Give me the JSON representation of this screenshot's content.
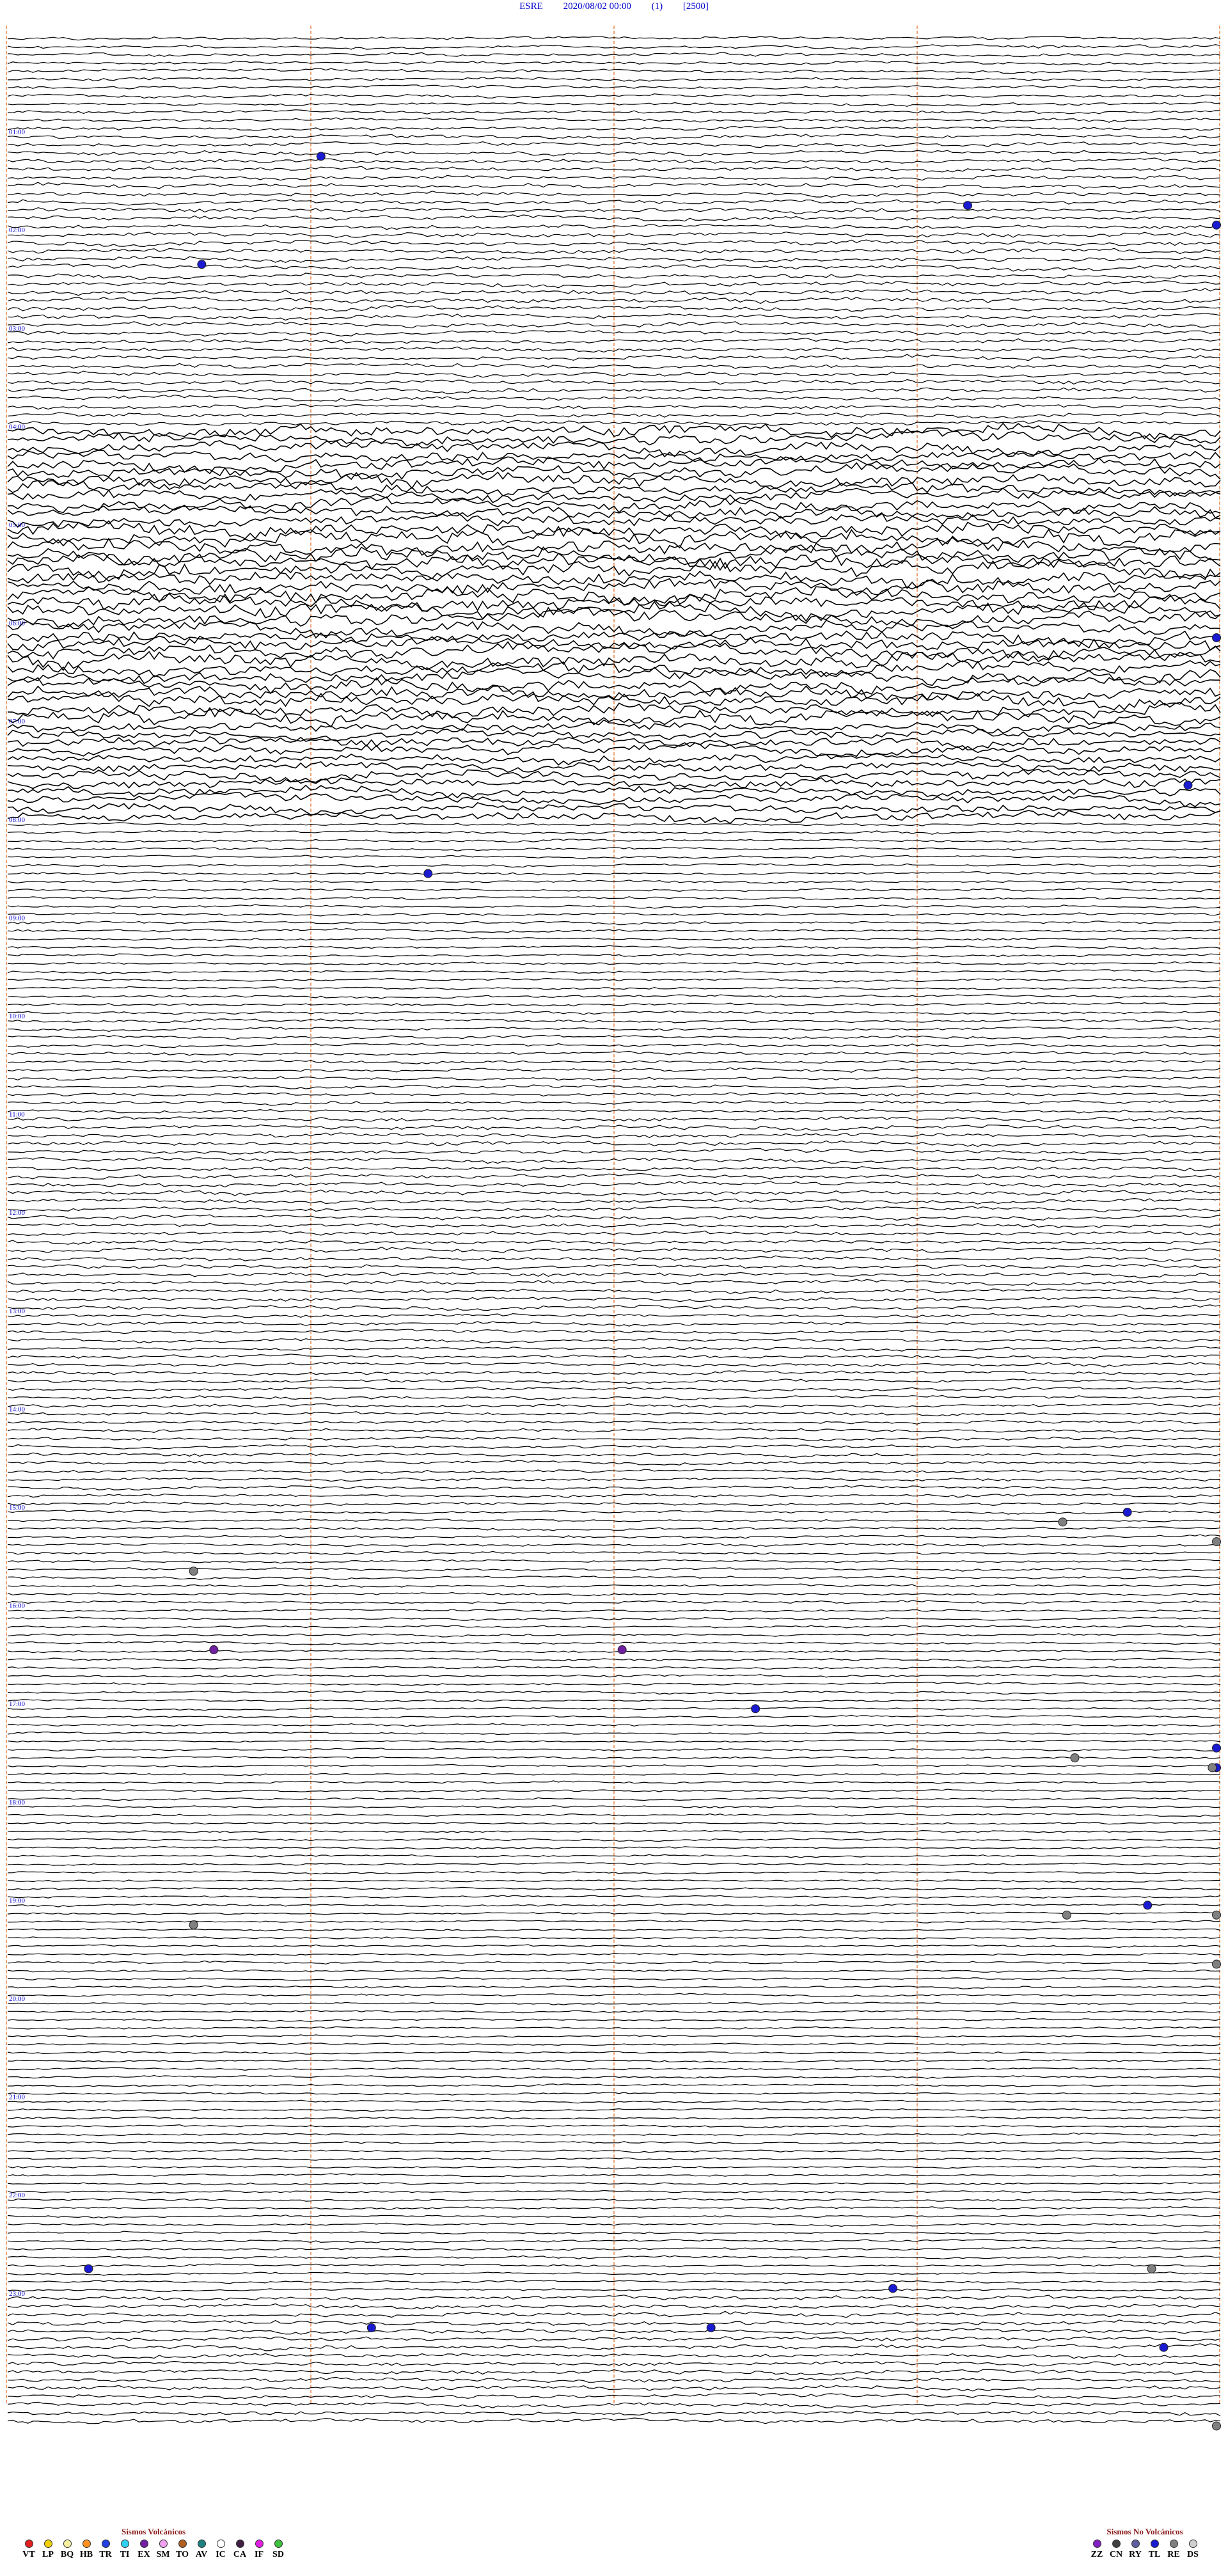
{
  "header": {
    "station": "ESRE",
    "datetime": "2020/08/02 00:00",
    "component": "(1)",
    "scale": "[2500]"
  },
  "chart_data": {
    "type": "line",
    "title": "ESRE 2020/08/02 00:00 (1) [2500]",
    "description_kind": "helicorder",
    "xlim_minutes": [
      0,
      60
    ],
    "minute_markers": [
      15,
      30,
      45,
      60
    ],
    "minute_marker_color": "#e8864a",
    "trace_color": "#000000",
    "hour_labels": [
      "01:00",
      "02:00",
      "03:00",
      "04:00",
      "05:00",
      "06:00",
      "07:00",
      "08:00",
      "09:00",
      "10:00",
      "11:00",
      "12:00",
      "13:00",
      "14:00",
      "15:00",
      "16:00",
      "17:00",
      "18:00",
      "19:00",
      "20:00",
      "21:00",
      "22:00",
      "23:00"
    ],
    "noise_profile_by_hour": [
      1.2,
      1.6,
      1.8,
      1.6,
      4.5,
      5.5,
      5.0,
      3.5,
      1.0,
      1.0,
      1.2,
      1.6,
      1.5,
      1.3,
      1.2,
      1.0,
      0.9,
      0.8,
      0.8,
      0.8,
      0.8,
      0.8,
      0.9,
      1.6
    ],
    "events": [
      {
        "hour": 1.2,
        "minute": 15.5,
        "type": "TL"
      },
      {
        "hour": 1.7,
        "minute": 47.5,
        "type": "TL"
      },
      {
        "hour": 1.9,
        "minute": 63.8,
        "type": "TL"
      },
      {
        "hour": 2.3,
        "minute": 9.6,
        "type": "TL"
      },
      {
        "hour": 6.1,
        "minute": 60.8,
        "type": "TL"
      },
      {
        "hour": 7.6,
        "minute": 58.4,
        "type": "TL"
      },
      {
        "hour": 8.5,
        "minute": 20.8,
        "type": "TL"
      },
      {
        "hour": 15.0,
        "minute": 55.4,
        "type": "TL"
      },
      {
        "hour": 17.0,
        "minute": 37.0,
        "type": "TL"
      },
      {
        "hour": 17.4,
        "minute": 60.8,
        "type": "TL"
      },
      {
        "hour": 17.6,
        "minute": 63.2,
        "type": "TL"
      },
      {
        "hour": 19.0,
        "minute": 56.4,
        "type": "TL"
      },
      {
        "hour": 22.7,
        "minute": 4.0,
        "type": "TL"
      },
      {
        "hour": 22.9,
        "minute": 43.8,
        "type": "TL"
      },
      {
        "hour": 23.3,
        "minute": 18.0,
        "type": "TL"
      },
      {
        "hour": 23.3,
        "minute": 34.8,
        "type": "TL"
      },
      {
        "hour": 23.5,
        "minute": 57.2,
        "type": "TL"
      },
      {
        "hour": 16.4,
        "minute": 10.2,
        "type": "EX"
      },
      {
        "hour": 16.4,
        "minute": 30.4,
        "type": "EX"
      },
      {
        "hour": 15.6,
        "minute": 9.2,
        "type": "RE"
      },
      {
        "hour": 19.2,
        "minute": 9.2,
        "type": "RE"
      },
      {
        "hour": 15.1,
        "minute": 52.2,
        "type": "RE"
      },
      {
        "hour": 15.3,
        "minute": 71.0,
        "type": "RE"
      },
      {
        "hour": 17.5,
        "minute": 52.8,
        "type": "RE"
      },
      {
        "hour": 17.6,
        "minute": 59.6,
        "type": "RE"
      },
      {
        "hour": 19.1,
        "minute": 52.4,
        "type": "RE"
      },
      {
        "hour": 19.1,
        "minute": 67.4,
        "type": "RE"
      },
      {
        "hour": 19.6,
        "minute": 66.6,
        "type": "RE"
      },
      {
        "hour": 22.7,
        "minute": 56.6,
        "type": "RE"
      },
      {
        "hour": 24.3,
        "minute": 69.4,
        "type": "RE"
      }
    ],
    "legend_volcanic": {
      "title": "Sismos Volcánicos",
      "items": [
        {
          "label": "VT",
          "color": "#e02020"
        },
        {
          "label": "LP",
          "color": "#f0d000"
        },
        {
          "label": "BQ",
          "color": "#f5f0a0"
        },
        {
          "label": "HB",
          "color": "#ff9020"
        },
        {
          "label": "TR",
          "color": "#2040e0"
        },
        {
          "label": "TI",
          "color": "#30d0f0"
        },
        {
          "label": "EX",
          "color": "#7020a0"
        },
        {
          "label": "SM",
          "color": "#f0a0f0"
        },
        {
          "label": "TO",
          "color": "#b06020"
        },
        {
          "label": "AV",
          "color": "#208080"
        },
        {
          "label": "IC",
          "color": "#ffffff"
        },
        {
          "label": "CA",
          "color": "#402040"
        },
        {
          "label": "IF",
          "color": "#e020e0"
        },
        {
          "label": "SD",
          "color": "#40c040"
        }
      ]
    },
    "legend_nonvolcanic": {
      "title": "Sismos No Volcánicos",
      "items": [
        {
          "label": "ZZ",
          "color": "#8020c0"
        },
        {
          "label": "CN",
          "color": "#404040"
        },
        {
          "label": "RY",
          "color": "#6060a0"
        },
        {
          "label": "TL",
          "color": "#1a1ad0"
        },
        {
          "label": "RE",
          "color": "#808080"
        },
        {
          "label": "DS",
          "color": "#d0d0d0"
        }
      ]
    }
  }
}
